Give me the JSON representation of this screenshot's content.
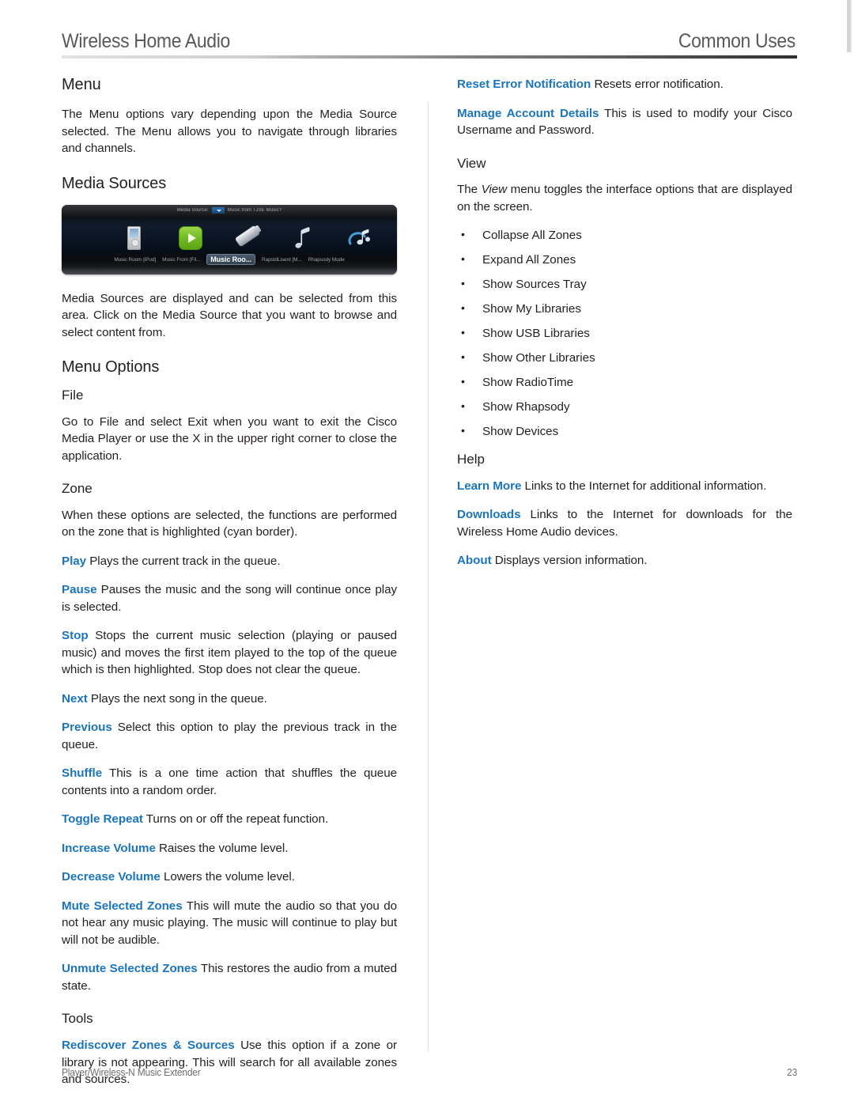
{
  "header": {
    "title": "Wireless Home Audio",
    "section": "Common Uses"
  },
  "footer": {
    "product": "Player/Wireless-N Music Extender",
    "page_number": "23"
  },
  "colors": {
    "term_blue": "#1b75bc",
    "body_text": "#231f20",
    "header_gray": "#58595b",
    "footer_gray": "#6d6e71",
    "divider": "#e4e4e6"
  },
  "left_column": {
    "menu": {
      "heading": "Menu",
      "paragraph": "The Menu options vary depending upon the Media Source selected. The Menu allows you to navigate through libraries and channels."
    },
    "media_sources": {
      "heading": "Media Sources",
      "figure": {
        "caption_bar_label": "Media Source:",
        "caption_bar_value": "Music from TJSE Music?",
        "items": [
          {
            "label": "Music Room [iPod]",
            "icon": "ipod-device-icon",
            "selected": false
          },
          {
            "label": "Music From [Fil...",
            "icon": "green-play-icon",
            "selected": false
          },
          {
            "label": "Music Roo...",
            "icon": "usb-stick-icon",
            "selected": true
          },
          {
            "label": "RapsIdLisent [M...",
            "icon": "music-notes-icon",
            "selected": false
          },
          {
            "label": "Rhapsody Mode",
            "icon": "rhapsody-notes-icon",
            "selected": false
          }
        ]
      },
      "paragraph": "Media Sources are displayed and can be selected from this area. Click on the Media Source that you want to browse and select content from."
    },
    "menu_options": {
      "heading": "Menu Options",
      "file": {
        "heading": "File",
        "paragraph": "Go to File and select Exit when you want to exit the Cisco Media Player or use the X in the upper right corner to close the application."
      },
      "zone": {
        "heading": "Zone",
        "intro": "When these options are selected, the functions are performed on the zone that is highlighted (cyan border).",
        "entries": [
          {
            "term": "Play",
            "desc": "Plays the current track in the queue."
          },
          {
            "term": "Pause",
            "desc": "Pauses the music and the song will continue once play is selected."
          },
          {
            "term": "Stop",
            "desc": "Stops the current music selection (playing or paused music) and moves the first item played to the top of the queue which is then highlighted. Stop does not clear the queue."
          },
          {
            "term": "Next",
            "desc": "Plays the next song in the queue."
          },
          {
            "term": "Previous",
            "desc": "Select this option to play the previous track in the queue."
          },
          {
            "term": "Shuffle",
            "desc": "This is a one time action that shuffles the queue contents into a random order."
          },
          {
            "term": "Toggle Repeat",
            "desc": "Turns on or off the repeat function."
          },
          {
            "term": "Increase Volume",
            "desc": "Raises the volume level."
          },
          {
            "term": "Decrease Volume",
            "desc": "Lowers the volume level."
          },
          {
            "term": "Mute Selected Zones",
            "desc": "This will mute the audio so that you do not hear any music playing. The music will continue to play but will not be audible."
          },
          {
            "term": "Unmute Selected Zones",
            "desc": "This restores the audio from a muted state."
          }
        ]
      },
      "tools": {
        "heading": "Tools",
        "entries": [
          {
            "term": "Rediscover Zones & Sources",
            "desc": "Use this option if a zone or library is not appearing. This will search for all available zones and sources."
          }
        ]
      }
    }
  },
  "right_column": {
    "tools_continued": {
      "entries": [
        {
          "term": "Reset Error Notification",
          "desc": "Resets error notification."
        },
        {
          "term": "Manage Account Details",
          "desc": "This is used to modify your Cisco Username and Password."
        }
      ]
    },
    "view": {
      "heading": "View",
      "intro_before": "The ",
      "intro_italic": "View",
      "intro_after": " menu toggles the interface options that are displayed on the screen.",
      "bullets": [
        "Collapse All Zones",
        "Expand All Zones",
        "Show Sources Tray",
        "Show My Libraries",
        "Show USB Libraries",
        "Show Other Libraries",
        "Show RadioTime",
        "Show Rhapsody",
        "Show Devices"
      ]
    },
    "help": {
      "heading": "Help",
      "entries": [
        {
          "term": "Learn More",
          "desc": "Links to the Internet for additional information."
        },
        {
          "term": "Downloads",
          "desc": "Links to the Internet for downloads for the Wireless Home Audio devices."
        },
        {
          "term": "About",
          "desc": "Displays version information."
        }
      ]
    }
  }
}
